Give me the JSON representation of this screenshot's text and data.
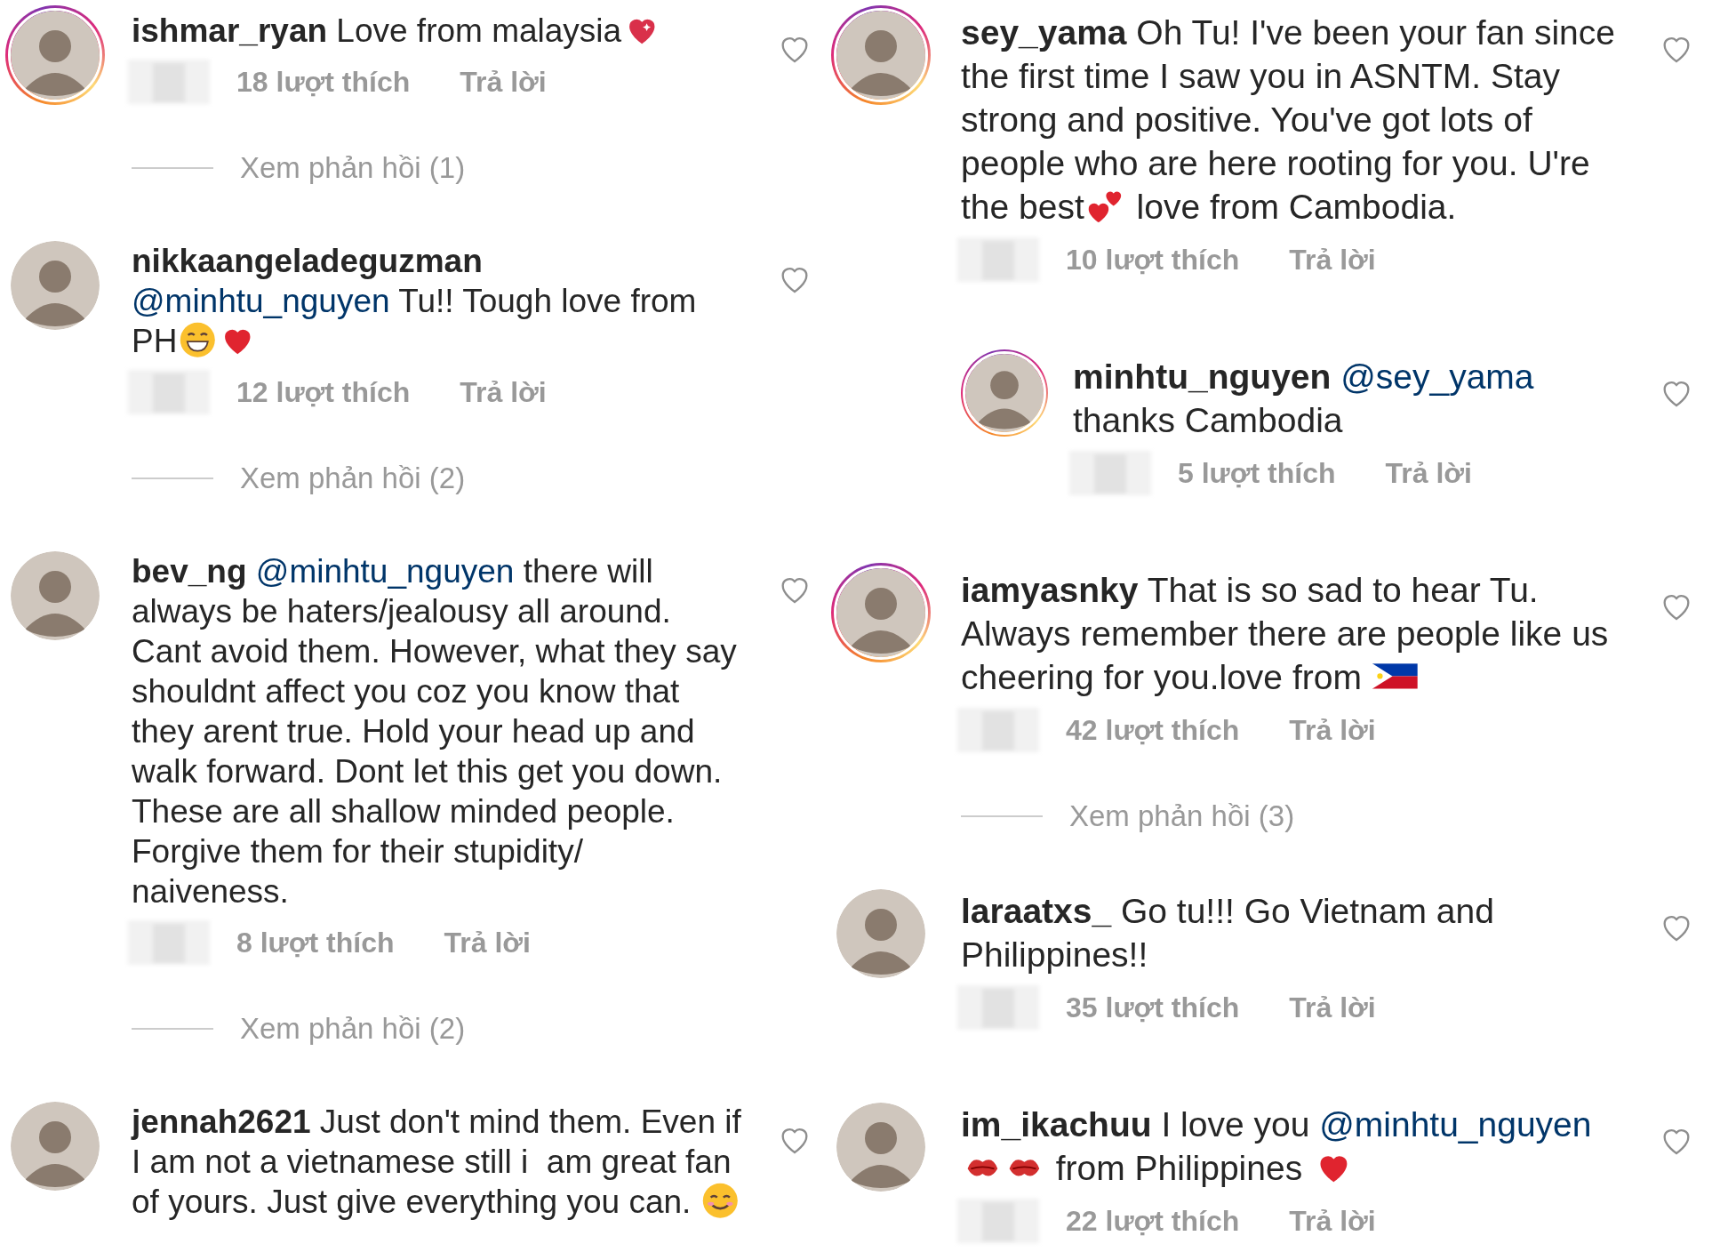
{
  "columns": [
    {
      "comments": [
        {
          "story_ring": true,
          "username": "ishmar_ryan",
          "body": [
            {
              "kind": "text",
              "text": "Love from malaysia"
            },
            {
              "kind": "sparkle-heart"
            }
          ],
          "likes": "18 lượt thích",
          "reply": "Trả lời",
          "view_replies": "Xem phản hồi (1)"
        },
        {
          "story_ring": false,
          "username": "nikkaangeladeguzman",
          "body": [
            {
              "kind": "mention",
              "text": "@minhtu_nguyen"
            },
            {
              "kind": "text",
              "text": " Tu!! Tough love from PH"
            },
            {
              "kind": "grin"
            },
            {
              "kind": "red-heart"
            }
          ],
          "likes": "12 lượt thích",
          "reply": "Trả lời",
          "view_replies": "Xem phản hồi (2)"
        },
        {
          "story_ring": false,
          "username": "bev_ng",
          "body": [
            {
              "kind": "mention",
              "text": "@minhtu_nguyen"
            },
            {
              "kind": "text",
              "text": " there will always be haters/jealousy all around. Cant avoid them. However, what they say shouldnt affect you coz you know that they arent true. Hold your head up and walk forward. Dont let this get you down. These are all shallow minded people. Forgive them for their stupidity/ naiveness."
            }
          ],
          "likes": "8 lượt thích",
          "reply": "Trả lời",
          "view_replies": "Xem phản hồi (2)"
        },
        {
          "story_ring": false,
          "username": "jennah2621",
          "body": [
            {
              "kind": "text",
              "text": "Just don't mind them. Even if I am not a vietnamese still i  am great fan of yours. Just give everything you can. "
            },
            {
              "kind": "smile"
            }
          ]
        }
      ]
    },
    {
      "comments": [
        {
          "story_ring": true,
          "username": "sey_yama",
          "body": [
            {
              "kind": "text",
              "text": "Oh Tu! I've been your fan since the first time I saw you in ASNTM. Stay strong and positive. You've got lots of people who are here rooting for you. U're the best"
            },
            {
              "kind": "two-hearts"
            },
            {
              "kind": "text",
              "text": " love from Cambodia."
            }
          ],
          "likes": "10 lượt thích",
          "reply": "Trả lời",
          "replies": [
            {
              "story_ring": true,
              "username": "minhtu_nguyen",
              "body": [
                {
                  "kind": "mention",
                  "text": "@sey_yama"
                },
                {
                  "kind": "text",
                  "text": " thanks Cambodia"
                }
              ],
              "likes": "5 lượt thích",
              "reply": "Trả lời"
            }
          ]
        },
        {
          "story_ring": true,
          "username": "iamyasnky",
          "body": [
            {
              "kind": "text",
              "text": "That is so sad to hear Tu. Always remember there are people like us cheering for you.love from "
            },
            {
              "kind": "flag"
            }
          ],
          "likes": "42 lượt thích",
          "reply": "Trả lời",
          "view_replies": "Xem phản hồi (3)"
        },
        {
          "story_ring": false,
          "username": "laraatxs_",
          "body": [
            {
              "kind": "text",
              "text": "Go tu!!! Go Vietnam and Philippines!!"
            }
          ],
          "likes": "35 lượt thích",
          "reply": "Trả lời"
        },
        {
          "story_ring": false,
          "username": "im_ikachuu",
          "body": [
            {
              "kind": "text",
              "text": "I love you "
            },
            {
              "kind": "mention",
              "text": "@minhtu_nguyen"
            },
            {
              "kind": "kiss"
            },
            {
              "kind": "kiss"
            },
            {
              "kind": "text",
              "text": " from Philippines "
            },
            {
              "kind": "beating-heart"
            }
          ],
          "likes": "22 lượt thích",
          "reply": "Trả lời"
        }
      ]
    }
  ]
}
